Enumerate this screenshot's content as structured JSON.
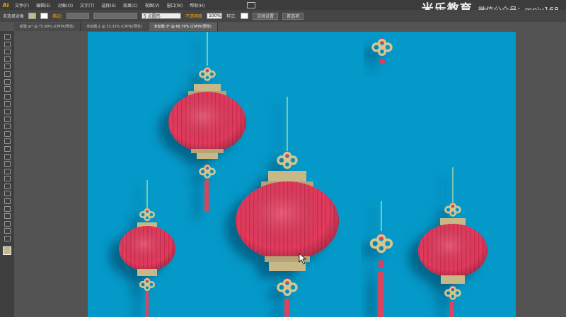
{
  "app": {
    "logo": "Ai"
  },
  "menubar": {
    "items": [
      "文件(F)",
      "编辑(E)",
      "对象(O)",
      "文字(T)",
      "选择(S)",
      "效果(C)",
      "视图(V)",
      "窗口(W)",
      "帮助(H)"
    ],
    "arrange_label": ""
  },
  "watermark": {
    "logo": "米乐教育",
    "wechat": "微信公众号：mnjy168"
  },
  "controlbar": {
    "selection_label": "未选择对象",
    "stroke_label": "描边:",
    "opacity_label": "不透明度",
    "opacity_value": "100%",
    "style_label": "样式:",
    "doc_setup_label": "文档设置",
    "prefs_label": "首选项",
    "brush_value": "5 点圆形"
  },
  "tabs": [
    {
      "label": "新建.ai* @ 75.99% (CMYK/预览)"
    },
    {
      "label": "未标题-1 @ 33.33% (CMYK/预览)"
    },
    {
      "label": "未标题-3* @ 66.70% (CMYK/预览)"
    }
  ],
  "colors": {
    "canvas": "#0499c9",
    "lantern": "#e23a5c",
    "gold": "#c8b887",
    "toolbar": "#3f3f3f"
  },
  "tools": [
    "selection-tool",
    "direct-selection-tool",
    "magic-wand-tool",
    "lasso-tool",
    "pen-tool",
    "type-tool",
    "line-tool",
    "rectangle-tool",
    "paintbrush-tool",
    "pencil-tool",
    "blob-brush-tool",
    "eraser-tool",
    "rotate-tool",
    "scale-tool",
    "width-tool",
    "free-transform-tool",
    "shape-builder-tool",
    "perspective-tool",
    "mesh-tool",
    "gradient-tool",
    "eyedropper-tool",
    "blend-tool",
    "symbol-sprayer-tool",
    "column-graph-tool",
    "artboard-tool",
    "slice-tool",
    "hand-tool",
    "zoom-tool"
  ]
}
